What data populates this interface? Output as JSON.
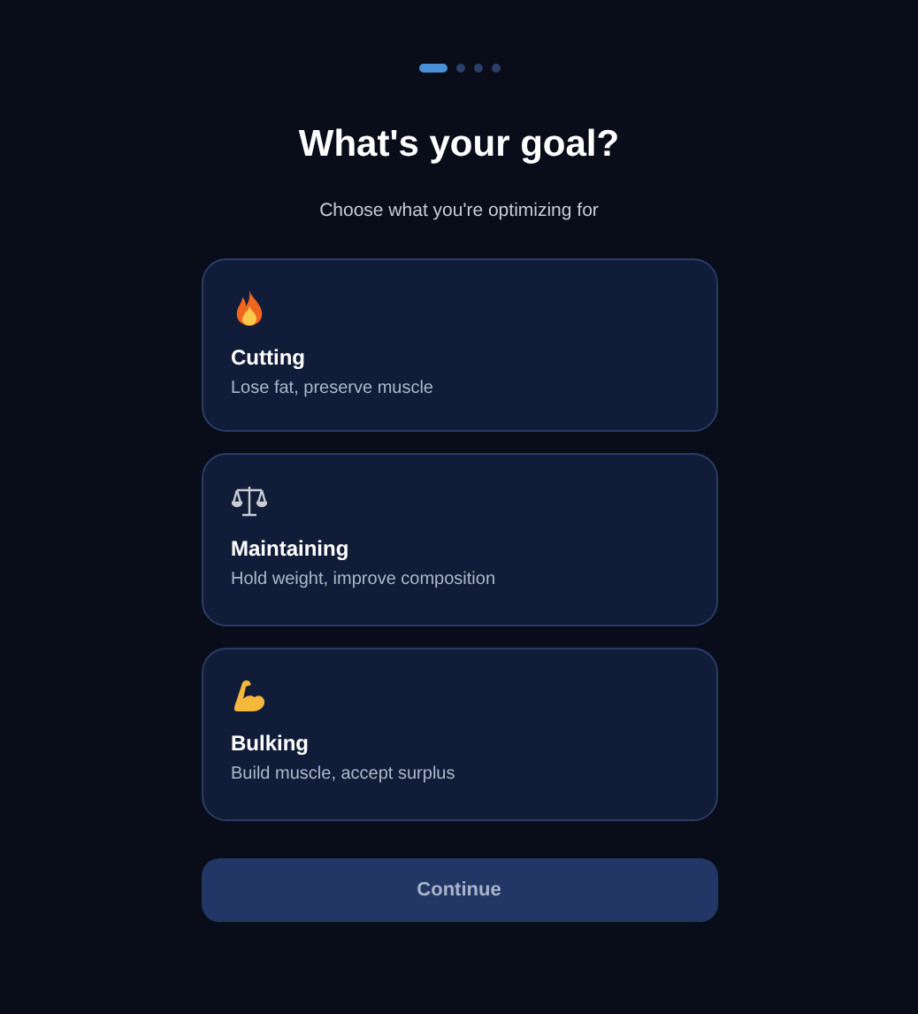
{
  "progress": {
    "steps": [
      {
        "selected": true
      },
      {
        "selected": false
      },
      {
        "selected": false
      },
      {
        "selected": false
      }
    ]
  },
  "title": "What's your goal?",
  "subtitle": "Choose what you're optimizing for",
  "options": [
    {
      "kind": "fire",
      "label": "Cutting",
      "description": "Lose fat, preserve muscle",
      "selected": false
    },
    {
      "kind": "scale",
      "label": "Maintaining",
      "description": "Hold weight, improve composition",
      "selected": false
    },
    {
      "kind": "muscle",
      "label": "Bulking",
      "description": "Build muscle, accept surplus",
      "selected": false
    }
  ],
  "continue_button": {
    "label": "Continue",
    "disabled": true
  }
}
